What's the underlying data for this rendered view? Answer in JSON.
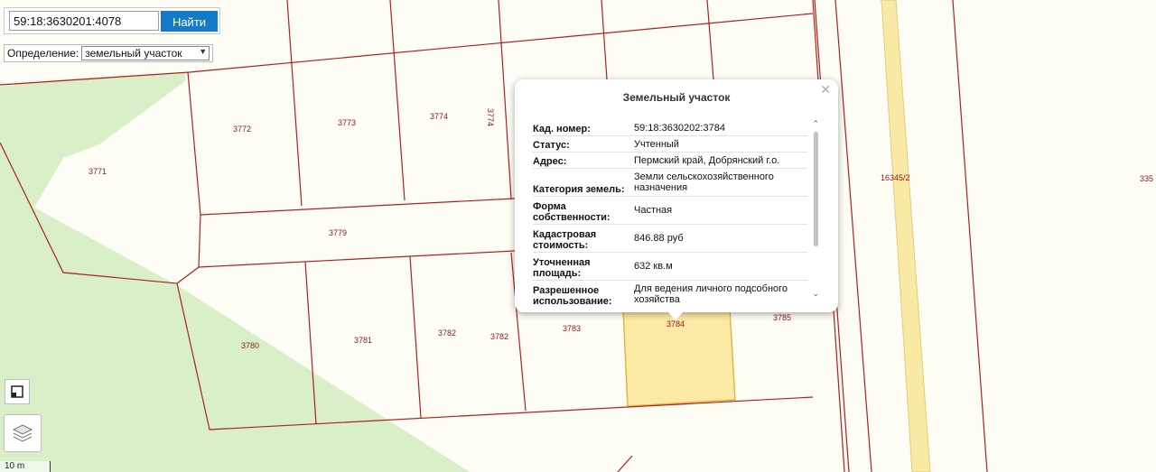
{
  "search": {
    "value": "59:18:3630201:4078",
    "button_label": "Найти"
  },
  "definition": {
    "label": "Определение:",
    "selected": "земельный участок"
  },
  "map": {
    "labels": {
      "p3771": "3771",
      "p3772": "3772",
      "p3773": "3773",
      "p3774": "3774",
      "p3779": "3779",
      "p3780": "3780",
      "p3781": "3781",
      "p3782a": "3782",
      "p3782b": "3782",
      "p3783": "3783",
      "p3784": "3784",
      "p3785": "3785",
      "p16345": "16345/2",
      "p335": "335"
    },
    "colors": {
      "forest": "#d8efc7",
      "boundary": "#b31e1e",
      "selected_parcel": "#fbe9a4",
      "road": "#f8eaa4"
    }
  },
  "popup": {
    "title": "Земельный участок",
    "rows": [
      {
        "key": "Кад. номер:",
        "value": "59:18:3630202:3784"
      },
      {
        "key": "Статус:",
        "value": "Учтенный"
      },
      {
        "key": "Адрес:",
        "value": "Пермский край, Добрянский г.о."
      },
      {
        "key": "Категория земель:",
        "value": "Земли сельскохозяйственного назначения"
      },
      {
        "key": "Форма собственности:",
        "value": "Частная"
      },
      {
        "key": "Кадастровая стоимость:",
        "value": "846.88 руб"
      },
      {
        "key": "Уточненная площадь:",
        "value": "632 кв.м"
      },
      {
        "key": "Разрешенное использование:",
        "value": "Для ведения личного подсобного хозяйства"
      }
    ]
  },
  "scale": {
    "label": "10 m"
  },
  "icons": {
    "close": "close-icon",
    "scroll_up": "chevron-up-icon",
    "scroll_down": "chevron-down-icon",
    "ruler": "ruler-icon",
    "layers": "layers-icon",
    "dropdown": "dropdown-arrow-icon"
  }
}
